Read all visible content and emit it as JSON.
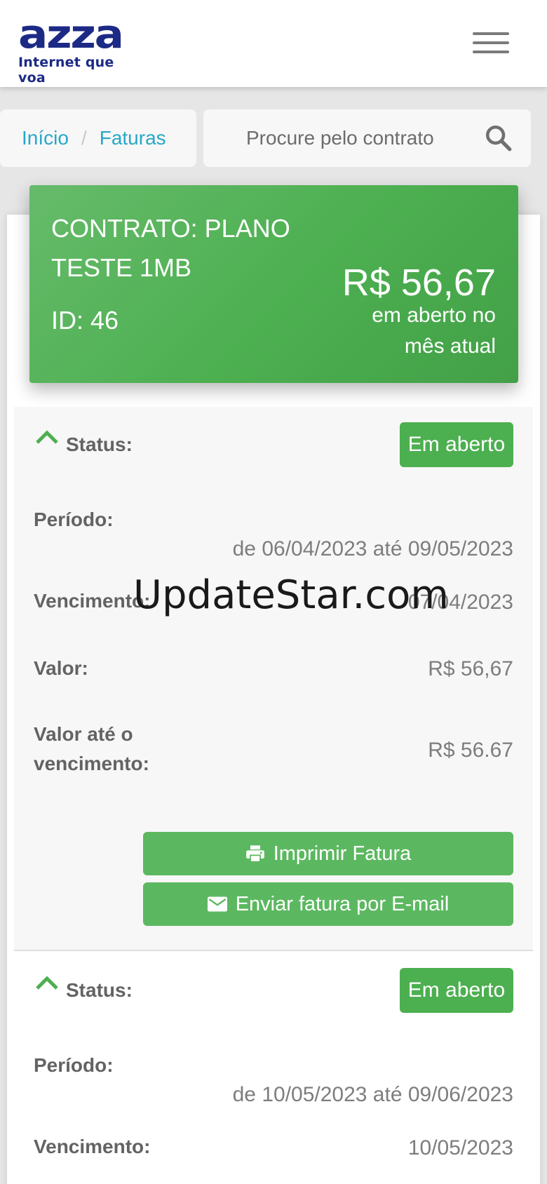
{
  "header": {
    "logo_word": "azza",
    "logo_tagline": "Internet que voa"
  },
  "breadcrumb": {
    "home": "Início",
    "separator": "/",
    "current": "Faturas"
  },
  "search": {
    "placeholder": "Procure pelo contrato"
  },
  "contract": {
    "title": "CONTRATO: PLANO TESTE 1MB",
    "id": "ID: 46",
    "amount": "R$ 56,67",
    "amount_note": "em aberto no mês atual"
  },
  "invoices": [
    {
      "status_label": "Status:",
      "status_value": "Em aberto",
      "period_label": "Período:",
      "period_value": "de 06/04/2023 até 09/05/2023",
      "due_label": "Vencimento:",
      "due_value": "07/04/2023",
      "value_label": "Valor:",
      "value_value": "R$ 56,67",
      "value_until_due_label": "Valor até o vencimento:",
      "value_until_due_value": "R$ 56.67",
      "print_button": "Imprimir Fatura",
      "email_button": "Enviar fatura por E-mail"
    },
    {
      "status_label": "Status:",
      "status_value": "Em aberto",
      "period_label": "Período:",
      "period_value": "de 10/05/2023 até 09/06/2023",
      "due_label": "Vencimento:",
      "due_value": "10/05/2023"
    }
  ],
  "watermark": "UpdateStar.com",
  "colors": {
    "brand_blue": "#1c2a86",
    "accent_green": "#4caf50",
    "link_cyan": "#26a8c8"
  }
}
